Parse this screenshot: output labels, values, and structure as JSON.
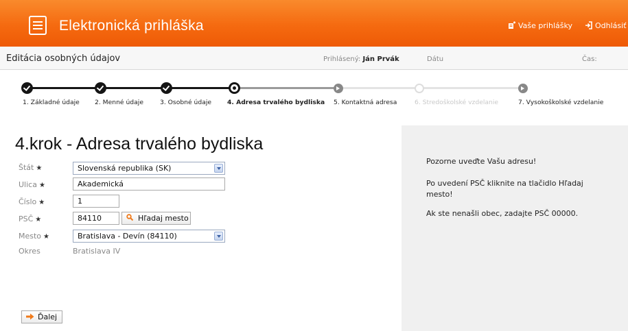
{
  "header": {
    "app_title": "Elektronická prihláška",
    "links": [
      {
        "label": "Vaše prihlášky",
        "icon": "applications-icon"
      },
      {
        "label": "Odhlásiť",
        "icon": "logout-icon"
      }
    ]
  },
  "subbar": {
    "page_title": "Editácia osobných údajov",
    "logged_label": "Prihlásený:",
    "logged_user": "Ján Prvák",
    "date_label": "Dátu",
    "time_label": "Čas:"
  },
  "steps": [
    {
      "label": "1. Základné údaje",
      "state": "done"
    },
    {
      "label": "2. Menné údaje",
      "state": "done"
    },
    {
      "label": "3. Osobné údaje",
      "state": "done"
    },
    {
      "label": "4. Adresa trvalého bydliska",
      "state": "current"
    },
    {
      "label": "5. Kontaktná adresa",
      "state": "next"
    },
    {
      "label": "6. Stredoškolské vzdelanie",
      "state": "disabled"
    },
    {
      "label": "7. Vysokoškolské vzdelanie",
      "state": "next"
    }
  ],
  "form": {
    "heading": "4.krok - Adresa trvalého bydliska",
    "required_mark": "★",
    "stat": {
      "label": "Štát",
      "value": "Slovenská republika (SK)"
    },
    "ulica": {
      "label": "Ulica",
      "value": "Akademická"
    },
    "cislo": {
      "label": "Číslo",
      "value": "1"
    },
    "psc": {
      "label": "PSČ",
      "value": "84110",
      "button": "Hľadaj mesto"
    },
    "mesto": {
      "label": "Mesto",
      "value": "Bratislava - Devín (84110)"
    },
    "okres": {
      "label": "Okres",
      "value": "Bratislava IV"
    },
    "next_button": "Ďalej"
  },
  "side_panel": {
    "messages": [
      "Pozorne uveďte Vašu adresu!",
      "Po uvedení PSČ kliknite na tlačidlo Hľadaj mesto!",
      "Ak ste nenašli obec, zadajte PSČ 00000."
    ]
  },
  "colors": {
    "header_orange": "#f56a10",
    "panel_gray": "#f0f0f0",
    "search_icon_orange": "#f07a1a",
    "next_arrow_orange": "#f07a1a"
  }
}
